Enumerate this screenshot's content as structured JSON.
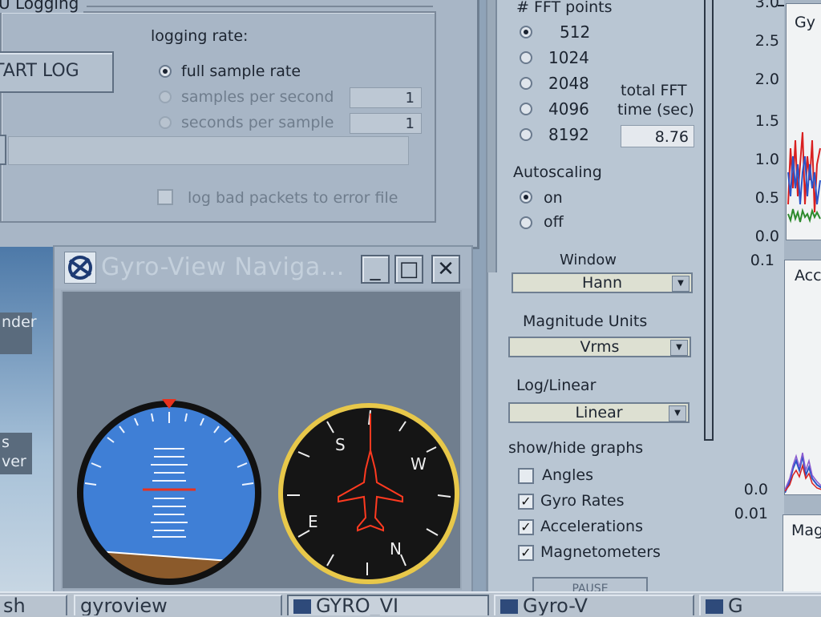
{
  "logging": {
    "title": "U Logging",
    "start_button": "TART LOG",
    "rate_label": "logging rate:",
    "options": [
      {
        "label": "full sample rate",
        "selected": true
      },
      {
        "label": "samples per second",
        "selected": false,
        "value": "1"
      },
      {
        "label": "seconds per sample",
        "selected": false,
        "value": "1"
      }
    ],
    "log_bad_packets_label": "log bad packets to error file",
    "log_bad_packets_checked": false
  },
  "desktop": {
    "icon_top_label": "nder",
    "icon_bottom_label": "s\nver"
  },
  "gyro_window": {
    "title": "Gyro-View Naviga...",
    "minimize": "_",
    "maximize": "□",
    "close": "✕",
    "compass_labels": {
      "north": "N",
      "south": "S",
      "east": "E",
      "west": "W"
    }
  },
  "panel": {
    "fft_points_label": "# FFT points",
    "fft_points": [
      {
        "value": "512",
        "selected": true
      },
      {
        "value": "1024",
        "selected": false
      },
      {
        "value": "2048",
        "selected": false
      },
      {
        "value": "4096",
        "selected": false
      },
      {
        "value": "8192",
        "selected": false
      }
    ],
    "total_fft_label_1": "total FFT",
    "total_fft_label_2": "time (sec)",
    "total_fft_value": "8.76",
    "autoscaling_label": "Autoscaling",
    "autoscaling_on": "on",
    "autoscaling_off": "off",
    "autoscaling_selected": "on",
    "window_label": "Window",
    "window_value": "Hann",
    "magnitude_label": "Magnitude Units",
    "magnitude_value": "Vrms",
    "loglin_label": "Log/Linear",
    "loglin_value": "Linear",
    "show_hide_label": "show/hide graphs",
    "graphs": [
      {
        "label": "Angles",
        "checked": false
      },
      {
        "label": "Gyro Rates",
        "checked": true
      },
      {
        "label": "Accelerations",
        "checked": true
      },
      {
        "label": "Magnetometers",
        "checked": true
      }
    ],
    "pause_button": "PAUSE"
  },
  "graphs": {
    "gyro_title": "Gy",
    "accel_title": "Acc",
    "mag_title": "Mag",
    "gyro_ticks": [
      "3.0",
      "2.5",
      "2.0",
      "1.5",
      "1.0",
      "0.5",
      "0.0"
    ],
    "accel_ticks": [
      "0.1",
      "0.0"
    ],
    "mag_ticks": [
      "0.01"
    ]
  },
  "taskbar": {
    "items": [
      {
        "label": "sh"
      },
      {
        "label": "gyroview"
      },
      {
        "label": "GYRO_VI",
        "active": true
      },
      {
        "label": "Gyro-V"
      },
      {
        "label": "G"
      }
    ]
  },
  "colors": {
    "horizon_sky": "#3f7fd6",
    "horizon_ground": "#8b5a2b",
    "compass_ring": "#e8c84a",
    "aircraft": "#ff3a20",
    "marker": "#e8321e"
  }
}
